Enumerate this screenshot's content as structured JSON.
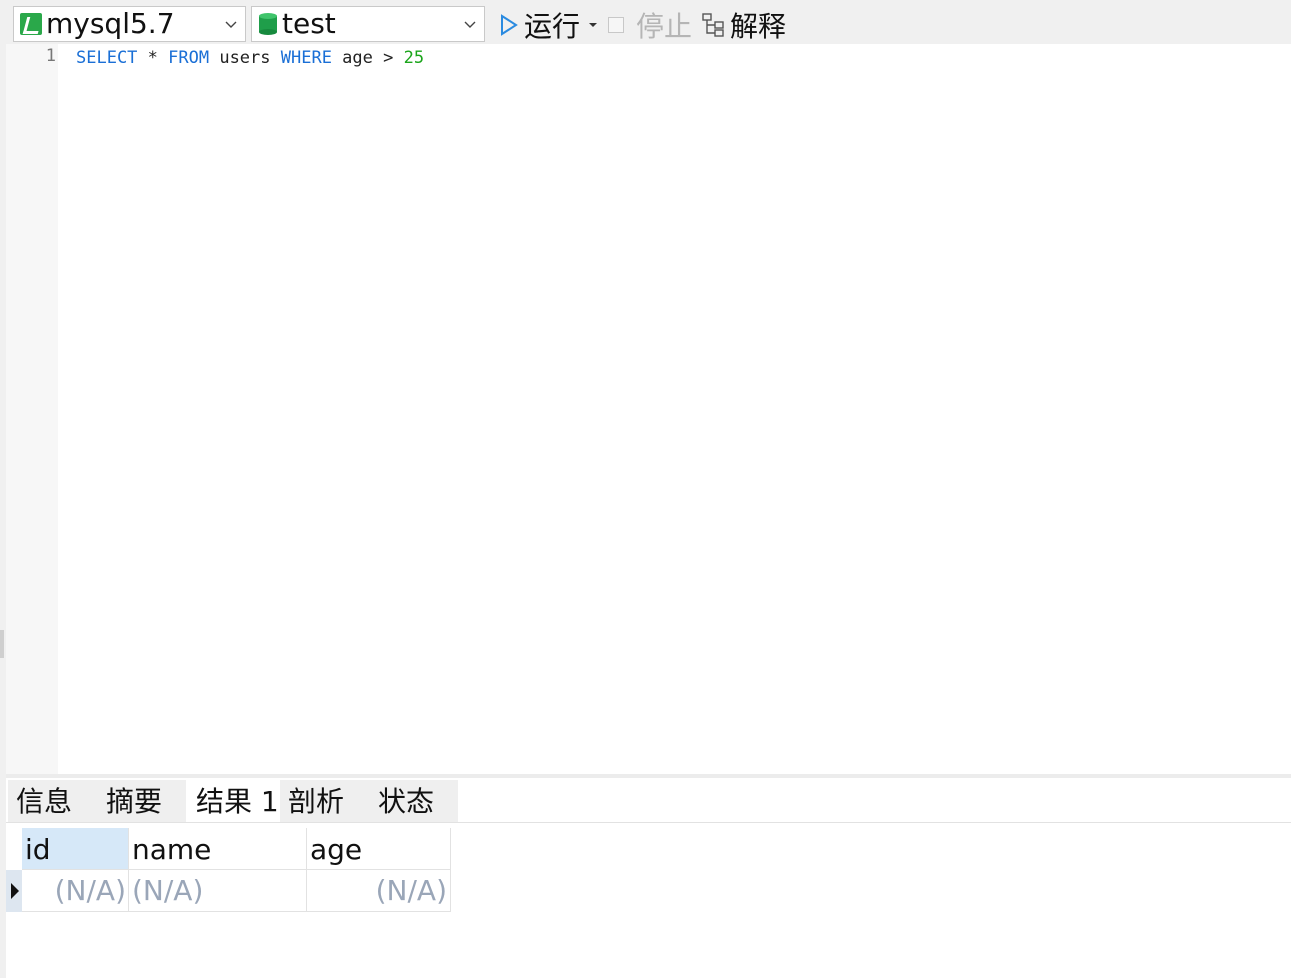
{
  "toolbar": {
    "connection": "mysql5.7",
    "database": "test",
    "run_label": "运行",
    "stop_label": "停止",
    "explain_label": "解释"
  },
  "editor": {
    "line_number": "1",
    "sql_tokens": [
      "SELECT",
      " * ",
      "FROM",
      " users ",
      "WHERE",
      " age > ",
      "25"
    ]
  },
  "tabs": [
    "信息",
    "摘要",
    "结果 1",
    "剖析",
    "状态"
  ],
  "active_tab": "结果 1",
  "result": {
    "columns": [
      "id",
      "name",
      "age"
    ],
    "rows": [
      [
        "(N/A)",
        "(N/A)",
        "(N/A)"
      ]
    ]
  },
  "colors": {
    "keyword": "#1a6fd6",
    "number": "#1ba51b",
    "connection_icon": "#2aa84a",
    "selected_header": "#d6e8f8",
    "null_text": "#9aa6b8"
  },
  "icons": [
    "connection-icon",
    "database-icon",
    "run-icon",
    "dropdown-icon",
    "stop-icon",
    "explain-icon",
    "row-pointer-icon"
  ]
}
